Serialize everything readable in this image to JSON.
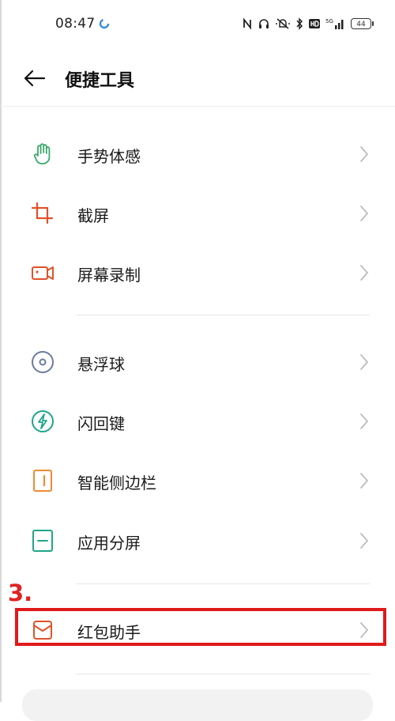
{
  "status_bar": {
    "time": "08:47",
    "battery": "44"
  },
  "header": {
    "title": "便捷工具"
  },
  "items": [
    {
      "label": "手势体感",
      "icon": "hand-gesture-icon",
      "color": "#3aa86b"
    },
    {
      "label": "截屏",
      "icon": "crop-screenshot-icon",
      "color": "#e0522a"
    },
    {
      "label": "屏幕录制",
      "icon": "screen-record-icon",
      "color": "#e0522a"
    },
    {
      "label": "悬浮球",
      "icon": "floating-ball-icon",
      "color": "#6b7ba0"
    },
    {
      "label": "闪回键",
      "icon": "flashback-key-icon",
      "color": "#1fa68a"
    },
    {
      "label": "智能侧边栏",
      "icon": "smart-sidebar-icon",
      "color": "#f08a35"
    },
    {
      "label": "应用分屏",
      "icon": "split-screen-icon",
      "color": "#1fa68a"
    },
    {
      "label": "红包助手",
      "icon": "red-envelope-icon",
      "color": "#e0522a"
    }
  ],
  "annotation": {
    "text": "3.",
    "color": "#e02222"
  }
}
